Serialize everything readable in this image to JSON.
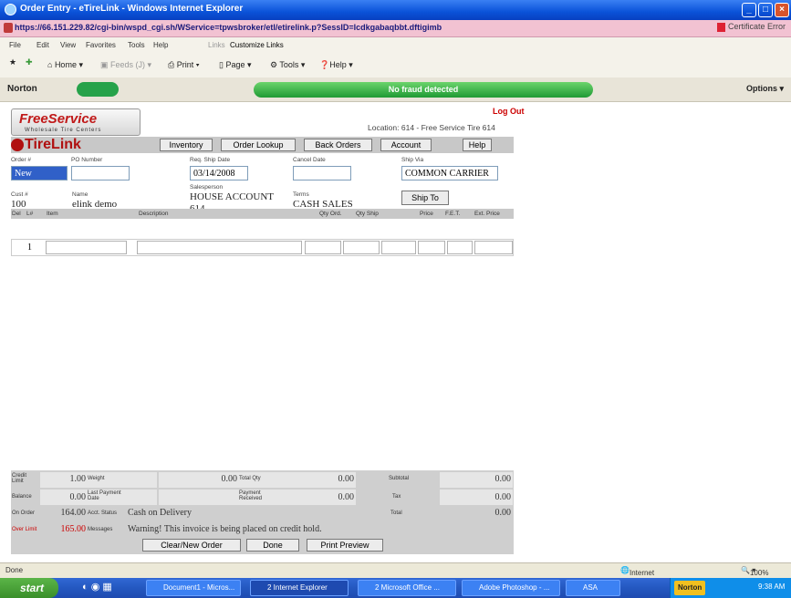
{
  "window": {
    "title": "Order Entry - eTireLink - Windows Internet Explorer",
    "url": "https://66.151.229.82/cgi-bin/wspd_cgi.sh/WService=tpwsbroker/etl/etirelink.p?SessID=lcdkgabaqbbt.dftigimb",
    "cert_error": "Certificate Error"
  },
  "menu": [
    "File",
    "Edit",
    "View",
    "Favorites",
    "Tools",
    "Help",
    "Links",
    "Customize Links"
  ],
  "commandbar": {
    "home": "Home",
    "feeds": "Feeds (J)",
    "print": "Print",
    "page": "Page",
    "tools": "Tools",
    "help": "Help"
  },
  "norton": {
    "label": "Norton",
    "status": "No fraud detected",
    "options": "Options"
  },
  "page": {
    "logo_line1": "FreeService",
    "logo_line2": "Wholesale Tire Centers",
    "logout": "Log Out",
    "location": "Location: 614 - Free Service Tire 614",
    "brand": "TireLink",
    "nav": [
      "Inventory",
      "Order Lookup",
      "Back Orders",
      "Account",
      "Help"
    ]
  },
  "form": {
    "order_label": "Order #",
    "order_value": "New",
    "po_label": "PO Number",
    "po_value": "",
    "req_ship_label": "Req. Ship Date",
    "req_ship_value": "03/14/2008",
    "cancel_label": "Cancel Date",
    "cancel_value": "",
    "ship_via_label": "Ship Via",
    "ship_via_value": "COMMON CARRIER",
    "cust_label": "Cust #",
    "cust_value": "100",
    "name_label": "Name",
    "name_value": "elink demo",
    "salesperson_label": "Salesperson",
    "salesperson_value": "HOUSE ACCOUNT",
    "salesperson_code": "614",
    "terms_label": "Terms",
    "terms_value": "CASH SALES",
    "ship_to_button": "Ship To"
  },
  "grid": {
    "headers": [
      "Del",
      "L#",
      "Item",
      "Description",
      "Qty Ord.",
      "Qty Ship",
      "Price",
      "F.E.T.",
      "Ext. Price"
    ],
    "row_number": "1"
  },
  "summary": {
    "credit_limit_label": "Credit Limit",
    "credit_limit": "1.00",
    "weight_label": "Weight",
    "weight": "0.00",
    "total_qty_label": "Total Qty",
    "total_qty": "0.00",
    "subtotal_label": "Subtotal",
    "subtotal": "0.00",
    "balance_label": "Balance",
    "balance": "0.00",
    "last_payment_label": "Last Payment Date",
    "payment_received_label": "Payment Received",
    "payment_received": "0.00",
    "tax_label": "Tax",
    "tax": "0.00",
    "on_order_label": "On Order",
    "on_order": "164.00",
    "acct_status_label": "Acct. Status",
    "acct_status": "Cash on Delivery",
    "total_label": "Total",
    "total": "0.00",
    "over_limit_label": "Over Limit",
    "over_limit": "165.00",
    "messages_label": "Messages",
    "message": "Warning! This invoice is being placed on credit hold."
  },
  "buttons": {
    "clear": "Clear/New Order",
    "done": "Done",
    "print_preview": "Print Preview"
  },
  "statusbar": {
    "left": "Done",
    "zone": "Internet",
    "zoom": "100%"
  },
  "taskbar": {
    "start": "start",
    "items": [
      "Document1 - Micros...",
      "2 Internet Explorer",
      "2 Microsoft Office ...",
      "Adobe Photoshop - ...",
      "ASA"
    ],
    "norton": "Norton",
    "clock": "9:38 AM"
  },
  "colors": {
    "accent_red": "#b01010",
    "norton_green": "#1f9a34",
    "title_blue": "#0a52d8"
  }
}
